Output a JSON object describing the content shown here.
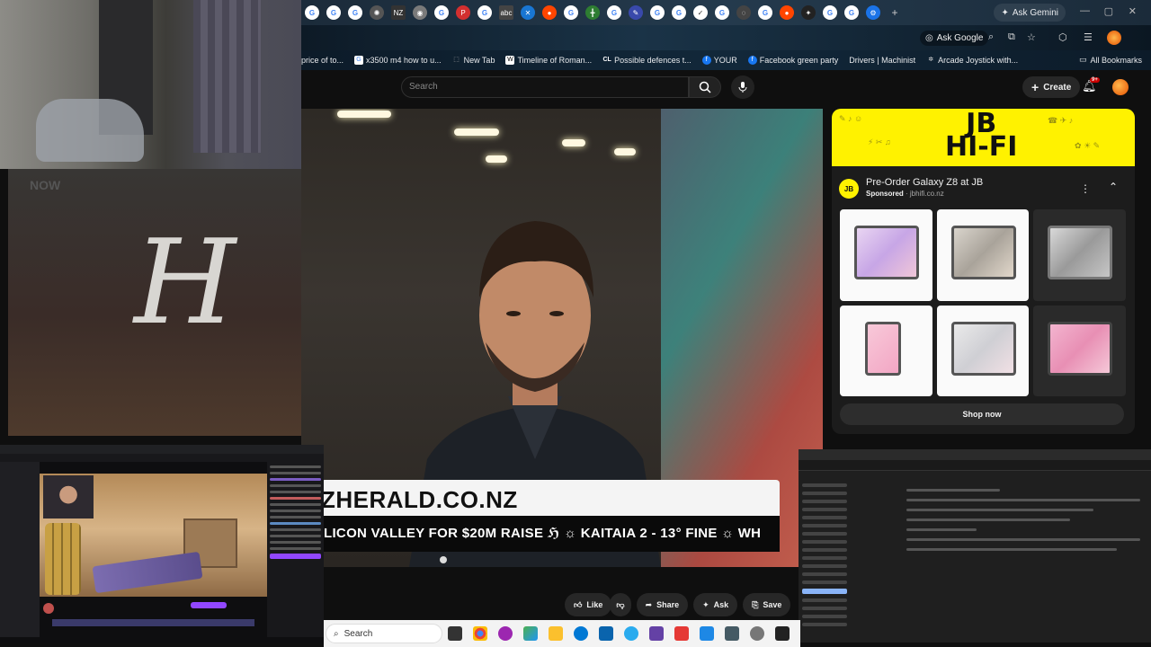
{
  "browser": {
    "ask_gemini": "Ask Gemini",
    "ask_google": "Ask Google",
    "bookmarks": [
      {
        "label": "price of to..."
      },
      {
        "label": "x3500 m4 how to u..."
      },
      {
        "label": "New Tab"
      },
      {
        "label": "Timeline of Roman..."
      },
      {
        "label": "Possible defences t..."
      },
      {
        "label": "YOUR"
      },
      {
        "label": "Facebook green party"
      },
      {
        "label": "Drivers | Machinist"
      },
      {
        "label": "Arcade Joystick with..."
      }
    ],
    "all_bookmarks": "All Bookmarks"
  },
  "youtube": {
    "search_placeholder": "Search",
    "create_label": "Create",
    "notification_count": "9+",
    "actions": {
      "like": "Like",
      "share": "Share",
      "ask": "Ask",
      "save": "Save"
    }
  },
  "video": {
    "banner_text": "ZHERALD.CO.NZ",
    "ticker_text": "LICON VALLEY FOR $20M RAISE  ℌ  ☼  KAITAIA 2 - 13° FINE  ☼  WH"
  },
  "ad": {
    "brand_line1": "JB",
    "brand_line2": "HI-FI",
    "title": "Pre-Order Galaxy Z8 at JB",
    "sponsored": "Sponsored",
    "domain": "jbhifi.co.nz",
    "cta": "Shop now"
  },
  "herald": {
    "now": "NOW",
    "logo": "H"
  },
  "taskbar": {
    "search_label": "Search"
  }
}
